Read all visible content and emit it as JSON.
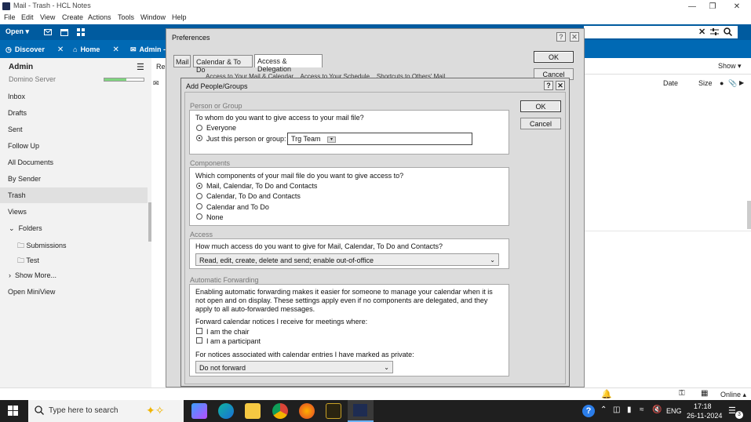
{
  "window": {
    "title": "Mail - Trash - HCL Notes",
    "controls": [
      "minimize-icon",
      "restore-icon",
      "close-icon"
    ]
  },
  "menu": [
    "File",
    "Edit",
    "View",
    "Create",
    "Actions",
    "Tools",
    "Window",
    "Help"
  ],
  "toolbar": {
    "open_label": "Open"
  },
  "tabs": [
    {
      "label": "Discover"
    },
    {
      "label": "Home"
    },
    {
      "label": "Admin -"
    }
  ],
  "sidebar": {
    "user": "Admin",
    "server": "Domino Server",
    "items": [
      "Inbox",
      "Drafts",
      "Sent",
      "Follow Up",
      "All Documents",
      "By Sender",
      "Trash",
      "Views"
    ],
    "selected": "Trash",
    "folders_label": "Folders",
    "subfolders": [
      "Submissions",
      "Test"
    ],
    "show_more": "Show More...",
    "open_miniview": "Open MiniView"
  },
  "view": {
    "col_left": "Re",
    "show_label": "Show",
    "col_date": "Date",
    "col_size": "Size"
  },
  "preferences": {
    "title": "Preferences",
    "tabs": [
      "Mail",
      "Calendar & To Do",
      "Access & Delegation"
    ],
    "subtabs": [
      "Access to Your Mail & Calendar",
      "Access to Your Schedule",
      "Shortcuts to Others' Mail"
    ],
    "ok": "OK",
    "cancel": "Cancel"
  },
  "add_people": {
    "title": "Add People/Groups",
    "ok": "OK",
    "cancel": "Cancel",
    "section_person": "Person or Group",
    "q_who": "To whom do you want to give access to your mail file?",
    "opt_everyone": "Everyone",
    "opt_just": "Just this person or group:",
    "person_value": "Trg Team",
    "section_components": "Components",
    "q_components": "Which components of your mail file do you want to give access to?",
    "components": [
      "Mail, Calendar, To Do and Contacts",
      "Calendar, To Do and Contacts",
      "Calendar and To Do",
      "None"
    ],
    "components_selected": "Mail, Calendar, To Do and Contacts",
    "section_access": "Access",
    "q_access": "How much access do you want to give for Mail, Calendar, To Do and Contacts?",
    "access_value": "Read, edit, create, delete and send; enable out-of-office",
    "section_forwarding": "Automatic Forwarding",
    "forward_desc": "Enabling automatic forwarding makes it easier for someone to manage your calendar when it is not open and on display.  These settings apply even if no components are delegated, and they apply to all auto-forwarded messages.",
    "forward_q": "Forward calendar notices I receive for meetings where:",
    "chk_chair": "I am the chair",
    "chk_participant": "I am a participant",
    "private_q": "For notices associated with calendar entries I have marked as private:",
    "private_value": "Do not forward"
  },
  "statusbar": {
    "online": "Online"
  },
  "taskbar": {
    "search_placeholder": "Type here to search",
    "lang": "ENG",
    "time": "17:18",
    "date": "26-11-2024",
    "notif_count": "3"
  },
  "colors": {
    "toolbar": "#005b9f",
    "tabs": "#0069b4",
    "dialog": "#dcdcdc",
    "taskbar": "#1f1f1f"
  }
}
